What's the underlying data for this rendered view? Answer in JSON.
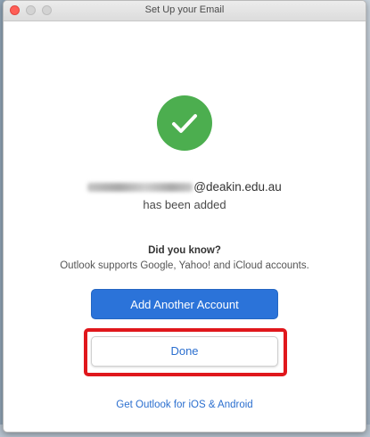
{
  "window": {
    "title": "Set Up your Email"
  },
  "success_icon": "checkmark-icon",
  "account": {
    "email_domain": "@deakin.edu.au",
    "added_text": "has been added"
  },
  "tip": {
    "heading": "Did you know?",
    "body": "Outlook supports Google, Yahoo! and iCloud accounts."
  },
  "buttons": {
    "add_another": "Add Another Account",
    "done": "Done"
  },
  "link": {
    "mobile": "Get Outlook for iOS & Android"
  },
  "colors": {
    "accent": "#2b73d9",
    "success": "#4cae4f",
    "highlight": "#e0171c"
  }
}
